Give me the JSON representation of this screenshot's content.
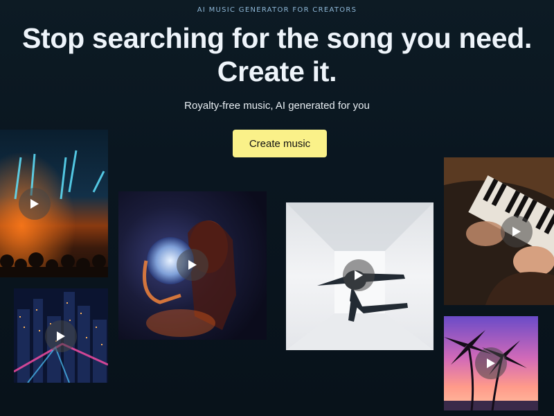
{
  "hero": {
    "eyebrow": "AI MUSIC GENERATOR FOR CREATORS",
    "headline_line1": "Stop searching for the song you need.",
    "headline_line2": "Create it.",
    "subtitle": "Royalty-free music, AI generated for you",
    "cta_label": "Create music"
  },
  "colors": {
    "background": "#0b1720",
    "cta_background": "#faf189",
    "eyebrow": "#8fb8d8"
  },
  "media_tiles": [
    {
      "name": "concert-lights-video",
      "icon": "play-icon"
    },
    {
      "name": "city-night-video",
      "icon": "play-icon"
    },
    {
      "name": "disco-ball-woman-video",
      "icon": "play-icon"
    },
    {
      "name": "dancer-white-room-video",
      "icon": "play-icon"
    },
    {
      "name": "piano-hands-video",
      "icon": "play-icon"
    },
    {
      "name": "palm-sunset-video",
      "icon": "play-icon"
    }
  ]
}
